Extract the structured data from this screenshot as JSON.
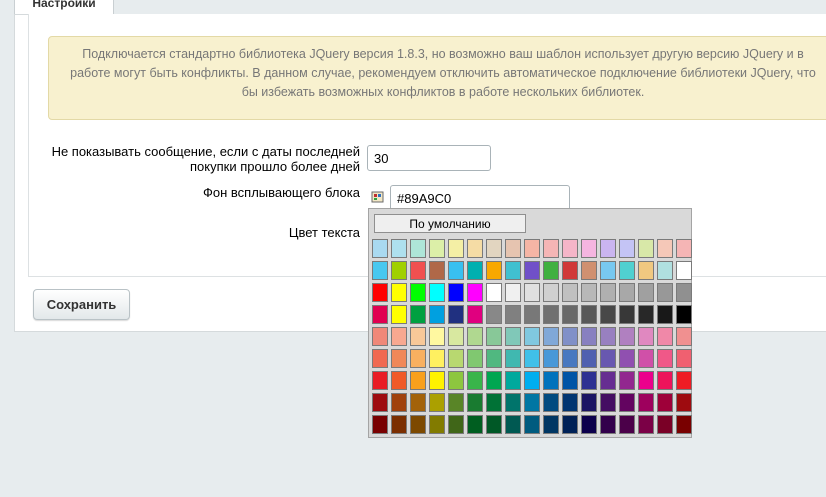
{
  "tabs": [
    {
      "label": "Настройки"
    }
  ],
  "notice": {
    "text": "Подключается стандартно библиотека JQuery версия 1.8.3, но возможно ваш шаблон использует другую версию JQuery и в работе могут быть конфликты. В данном случае, рекомендуем отключить автоматическое подключение библиотеки JQuery, что бы избежать возможных конфликтов в работе нескольких библиотек."
  },
  "fields": {
    "days": {
      "label": "Не показывать сообщение, если с даты последней покупки прошло более дней",
      "value": "30"
    },
    "popup_bg": {
      "label": "Фон всплывающего блока",
      "value": "#89A9C0",
      "picker_icon": "palette-icon"
    },
    "text_color": {
      "label": "Цвет текста"
    }
  },
  "save_label": "Сохранить",
  "palette": {
    "default_label": "По умолчанию",
    "rows": [
      [
        "#a9d9f0",
        "#aee0ee",
        "#aee6d8",
        "#dcefa8",
        "#f4efa5",
        "#f5dca5",
        "#e2d5c0",
        "#e6c4b0",
        "#f5b5a5",
        "#f5b5b5",
        "#f5b5c8",
        "#f5b5e0",
        "#cab5f0",
        "#c4c4f5",
        "#d8e8a8",
        "#f5c8b8",
        "#f5b5b5"
      ],
      [
        "#48c8f0",
        "#a0d000",
        "#f05050",
        "#b06848",
        "#38c0f0",
        "#00b0b0",
        "#f8a800",
        "#40c0d0",
        "#7050c8",
        "#40b040",
        "#d03838",
        "#d09070",
        "#78c8f0",
        "#50d0d0",
        "#f0c880",
        "#b0e0e0",
        "#ffffff"
      ],
      [
        "#ff0000",
        "#ffff00",
        "#00ff00",
        "#00ffff",
        "#0000ff",
        "#ff00ff",
        "#ffffff",
        "#f0f0f0",
        "#e0e0e0",
        "#d0d0d0",
        "#c0c0c0",
        "#b8b8b8",
        "#b0b0b0",
        "#a8a8a8",
        "#a0a0a0",
        "#989898",
        "#909090"
      ],
      [
        "#e00050",
        "#ffff00",
        "#00a040",
        "#00a0e0",
        "#203080",
        "#e0007f",
        "#888888",
        "#808080",
        "#787878",
        "#707070",
        "#686868",
        "#585858",
        "#484848",
        "#383838",
        "#282828",
        "#181818",
        "#000000"
      ],
      [
        "#f08878",
        "#f8a890",
        "#f8c898",
        "#fff8a0",
        "#d8e8a0",
        "#b0d890",
        "#88c898",
        "#80c8b8",
        "#80c8e0",
        "#80a8d8",
        "#8090c8",
        "#8880c0",
        "#9880c0",
        "#b080c0",
        "#e088c0",
        "#f088a8",
        "#f09090"
      ],
      [
        "#f06850",
        "#f08858",
        "#f8b060",
        "#fff060",
        "#b8d870",
        "#80c870",
        "#50b880",
        "#40b8b0",
        "#40c0e8",
        "#4898d8",
        "#4878c0",
        "#5060b0",
        "#6858b0",
        "#9050b0",
        "#d050a8",
        "#f05888",
        "#f06070"
      ],
      [
        "#e81c24",
        "#f05a28",
        "#f8a01c",
        "#fff200",
        "#8dc63f",
        "#39b54a",
        "#00a651",
        "#00a99d",
        "#00aeef",
        "#0072bc",
        "#0054a6",
        "#2e3192",
        "#662d91",
        "#92278f",
        "#ec008c",
        "#ed145b",
        "#ee1c24"
      ],
      [
        "#9e0b0f",
        "#a0410d",
        "#a36209",
        "#aba000",
        "#598527",
        "#197b30",
        "#007236",
        "#00746b",
        "#0076a3",
        "#004a80",
        "#003471",
        "#1b1464",
        "#440e62",
        "#630460",
        "#9e005d",
        "#9e0039",
        "#9e0b0f"
      ],
      [
        "#790000",
        "#7b2e00",
        "#7d4900",
        "#827b00",
        "#406618",
        "#005e20",
        "#005826",
        "#005952",
        "#005b7f",
        "#003663",
        "#002157",
        "#0d004c",
        "#32004b",
        "#4b0049",
        "#7b0046",
        "#7a0026",
        "#790000"
      ]
    ]
  }
}
